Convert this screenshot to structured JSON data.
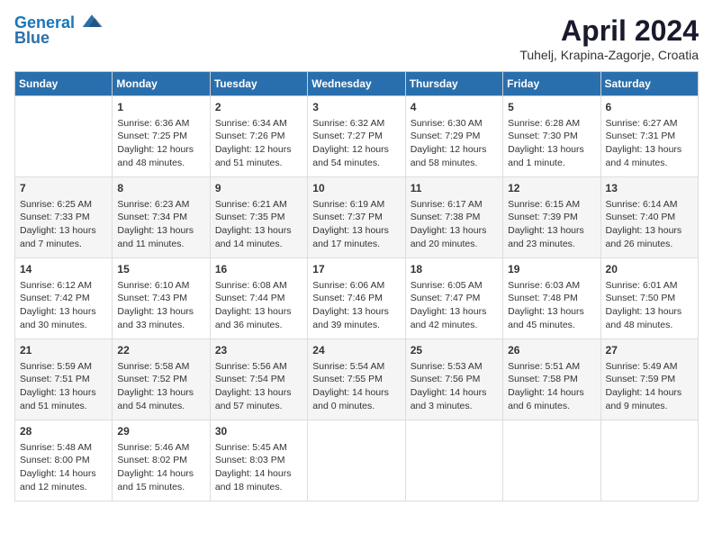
{
  "header": {
    "logo_line1": "General",
    "logo_line2": "Blue",
    "month": "April 2024",
    "location": "Tuhelj, Krapina-Zagorje, Croatia"
  },
  "columns": [
    "Sunday",
    "Monday",
    "Tuesday",
    "Wednesday",
    "Thursday",
    "Friday",
    "Saturday"
  ],
  "weeks": [
    [
      {
        "day": "",
        "content": ""
      },
      {
        "day": "1",
        "content": "Sunrise: 6:36 AM\nSunset: 7:25 PM\nDaylight: 12 hours\nand 48 minutes."
      },
      {
        "day": "2",
        "content": "Sunrise: 6:34 AM\nSunset: 7:26 PM\nDaylight: 12 hours\nand 51 minutes."
      },
      {
        "day": "3",
        "content": "Sunrise: 6:32 AM\nSunset: 7:27 PM\nDaylight: 12 hours\nand 54 minutes."
      },
      {
        "day": "4",
        "content": "Sunrise: 6:30 AM\nSunset: 7:29 PM\nDaylight: 12 hours\nand 58 minutes."
      },
      {
        "day": "5",
        "content": "Sunrise: 6:28 AM\nSunset: 7:30 PM\nDaylight: 13 hours\nand 1 minute."
      },
      {
        "day": "6",
        "content": "Sunrise: 6:27 AM\nSunset: 7:31 PM\nDaylight: 13 hours\nand 4 minutes."
      }
    ],
    [
      {
        "day": "7",
        "content": "Sunrise: 6:25 AM\nSunset: 7:33 PM\nDaylight: 13 hours\nand 7 minutes."
      },
      {
        "day": "8",
        "content": "Sunrise: 6:23 AM\nSunset: 7:34 PM\nDaylight: 13 hours\nand 11 minutes."
      },
      {
        "day": "9",
        "content": "Sunrise: 6:21 AM\nSunset: 7:35 PM\nDaylight: 13 hours\nand 14 minutes."
      },
      {
        "day": "10",
        "content": "Sunrise: 6:19 AM\nSunset: 7:37 PM\nDaylight: 13 hours\nand 17 minutes."
      },
      {
        "day": "11",
        "content": "Sunrise: 6:17 AM\nSunset: 7:38 PM\nDaylight: 13 hours\nand 20 minutes."
      },
      {
        "day": "12",
        "content": "Sunrise: 6:15 AM\nSunset: 7:39 PM\nDaylight: 13 hours\nand 23 minutes."
      },
      {
        "day": "13",
        "content": "Sunrise: 6:14 AM\nSunset: 7:40 PM\nDaylight: 13 hours\nand 26 minutes."
      }
    ],
    [
      {
        "day": "14",
        "content": "Sunrise: 6:12 AM\nSunset: 7:42 PM\nDaylight: 13 hours\nand 30 minutes."
      },
      {
        "day": "15",
        "content": "Sunrise: 6:10 AM\nSunset: 7:43 PM\nDaylight: 13 hours\nand 33 minutes."
      },
      {
        "day": "16",
        "content": "Sunrise: 6:08 AM\nSunset: 7:44 PM\nDaylight: 13 hours\nand 36 minutes."
      },
      {
        "day": "17",
        "content": "Sunrise: 6:06 AM\nSunset: 7:46 PM\nDaylight: 13 hours\nand 39 minutes."
      },
      {
        "day": "18",
        "content": "Sunrise: 6:05 AM\nSunset: 7:47 PM\nDaylight: 13 hours\nand 42 minutes."
      },
      {
        "day": "19",
        "content": "Sunrise: 6:03 AM\nSunset: 7:48 PM\nDaylight: 13 hours\nand 45 minutes."
      },
      {
        "day": "20",
        "content": "Sunrise: 6:01 AM\nSunset: 7:50 PM\nDaylight: 13 hours\nand 48 minutes."
      }
    ],
    [
      {
        "day": "21",
        "content": "Sunrise: 5:59 AM\nSunset: 7:51 PM\nDaylight: 13 hours\nand 51 minutes."
      },
      {
        "day": "22",
        "content": "Sunrise: 5:58 AM\nSunset: 7:52 PM\nDaylight: 13 hours\nand 54 minutes."
      },
      {
        "day": "23",
        "content": "Sunrise: 5:56 AM\nSunset: 7:54 PM\nDaylight: 13 hours\nand 57 minutes."
      },
      {
        "day": "24",
        "content": "Sunrise: 5:54 AM\nSunset: 7:55 PM\nDaylight: 14 hours\nand 0 minutes."
      },
      {
        "day": "25",
        "content": "Sunrise: 5:53 AM\nSunset: 7:56 PM\nDaylight: 14 hours\nand 3 minutes."
      },
      {
        "day": "26",
        "content": "Sunrise: 5:51 AM\nSunset: 7:58 PM\nDaylight: 14 hours\nand 6 minutes."
      },
      {
        "day": "27",
        "content": "Sunrise: 5:49 AM\nSunset: 7:59 PM\nDaylight: 14 hours\nand 9 minutes."
      }
    ],
    [
      {
        "day": "28",
        "content": "Sunrise: 5:48 AM\nSunset: 8:00 PM\nDaylight: 14 hours\nand 12 minutes."
      },
      {
        "day": "29",
        "content": "Sunrise: 5:46 AM\nSunset: 8:02 PM\nDaylight: 14 hours\nand 15 minutes."
      },
      {
        "day": "30",
        "content": "Sunrise: 5:45 AM\nSunset: 8:03 PM\nDaylight: 14 hours\nand 18 minutes."
      },
      {
        "day": "",
        "content": ""
      },
      {
        "day": "",
        "content": ""
      },
      {
        "day": "",
        "content": ""
      },
      {
        "day": "",
        "content": ""
      }
    ]
  ]
}
